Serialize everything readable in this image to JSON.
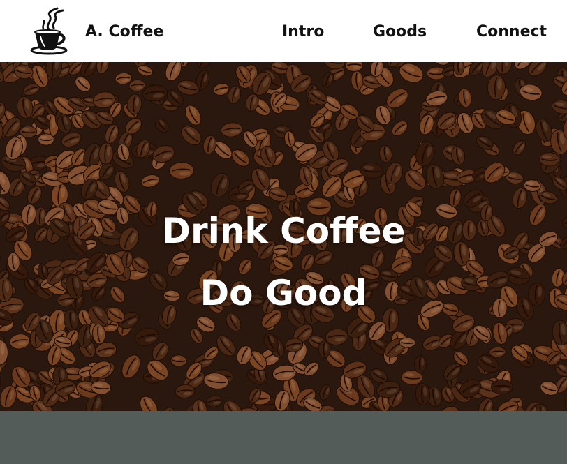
{
  "header": {
    "brand": "A. Coffee",
    "logo_icon": "coffee-cup-icon",
    "nav": [
      {
        "label": "Intro"
      },
      {
        "label": "Goods"
      },
      {
        "label": "Connect"
      }
    ]
  },
  "hero": {
    "line1": "Drink Coffee",
    "line2": "Do Good",
    "background_image": "coffee-beans-photo"
  },
  "colors": {
    "header_bg": "#ffffff",
    "text": "#111111",
    "hero_text": "#ffffff",
    "band": "#535c58"
  }
}
